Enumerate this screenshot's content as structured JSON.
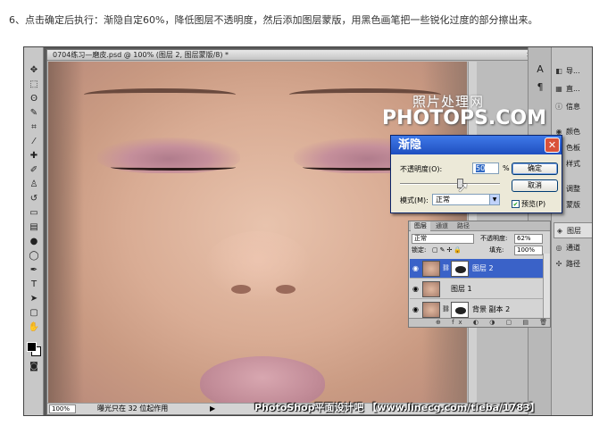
{
  "caption": "6、点击确定后执行：渐隐自定60%，降低图层不透明度，然后添加图层蒙版，用黑色画笔把一些锐化过度的部分擦出来。",
  "document": {
    "title": "0704练习—磨皮.psd @ 100% (图层 2, 图层蒙版/8) *",
    "zoom": "100%",
    "status": "曝光只在 32 位起作用",
    "status_arrow": "▶"
  },
  "watermark": {
    "chinese": "照片处理网",
    "english": "PHOTOPS.COM"
  },
  "fade_dialog": {
    "title": "渐隐",
    "close_label": "✕",
    "opacity_label": "不透明度(O):",
    "opacity_value": "50",
    "percent": "%",
    "ok_label": "确定",
    "cancel_label": "取消",
    "mode_label": "模式(M):",
    "mode_value": "正常",
    "preview_label": "预览(P)",
    "preview_checked": true,
    "opacity_slider_fraction": 0.6
  },
  "layers_panel": {
    "tabs": [
      "图层",
      "通道",
      "路径"
    ],
    "blend_mode": "正常",
    "opacity_label": "不透明度:",
    "opacity_value": "62%",
    "lock_label": "锁定:",
    "fill_label": "填充:",
    "fill_value": "100%",
    "layers": [
      {
        "name": "图层 2",
        "selected": true,
        "has_mask": true
      },
      {
        "name": "图层 1",
        "selected": false,
        "has_mask": false
      },
      {
        "name": "背景 副本 2",
        "selected": false,
        "has_mask": true
      }
    ],
    "bottom_icons": "⊕ fx ◐ ◑ ▢ ▤ 🗑"
  },
  "dock": {
    "items": [
      {
        "icon": "◧",
        "label": "导..."
      },
      {
        "icon": "▦",
        "label": "直..."
      },
      {
        "icon": "ⓘ",
        "label": "信息"
      },
      {
        "icon": "◉",
        "label": "颜色"
      },
      {
        "icon": "▦",
        "label": "色板"
      },
      {
        "icon": "◆",
        "label": "样式"
      },
      {
        "icon": "◐",
        "label": "调整"
      },
      {
        "icon": "▣",
        "label": "蒙版"
      },
      {
        "icon": "◈",
        "label": "图层"
      },
      {
        "icon": "◎",
        "label": "通道"
      },
      {
        "icon": "✣",
        "label": "路径"
      }
    ],
    "small_icons": [
      "A",
      "¶"
    ]
  },
  "footer_watermark": "PhotoShop平面设计吧 【www.linecg.com/tieba/1783】",
  "colors": {
    "dialog_title_bar": "#3f79e8",
    "selected_layer": "#3a62c8",
    "dialog_close": "#d9523a"
  }
}
